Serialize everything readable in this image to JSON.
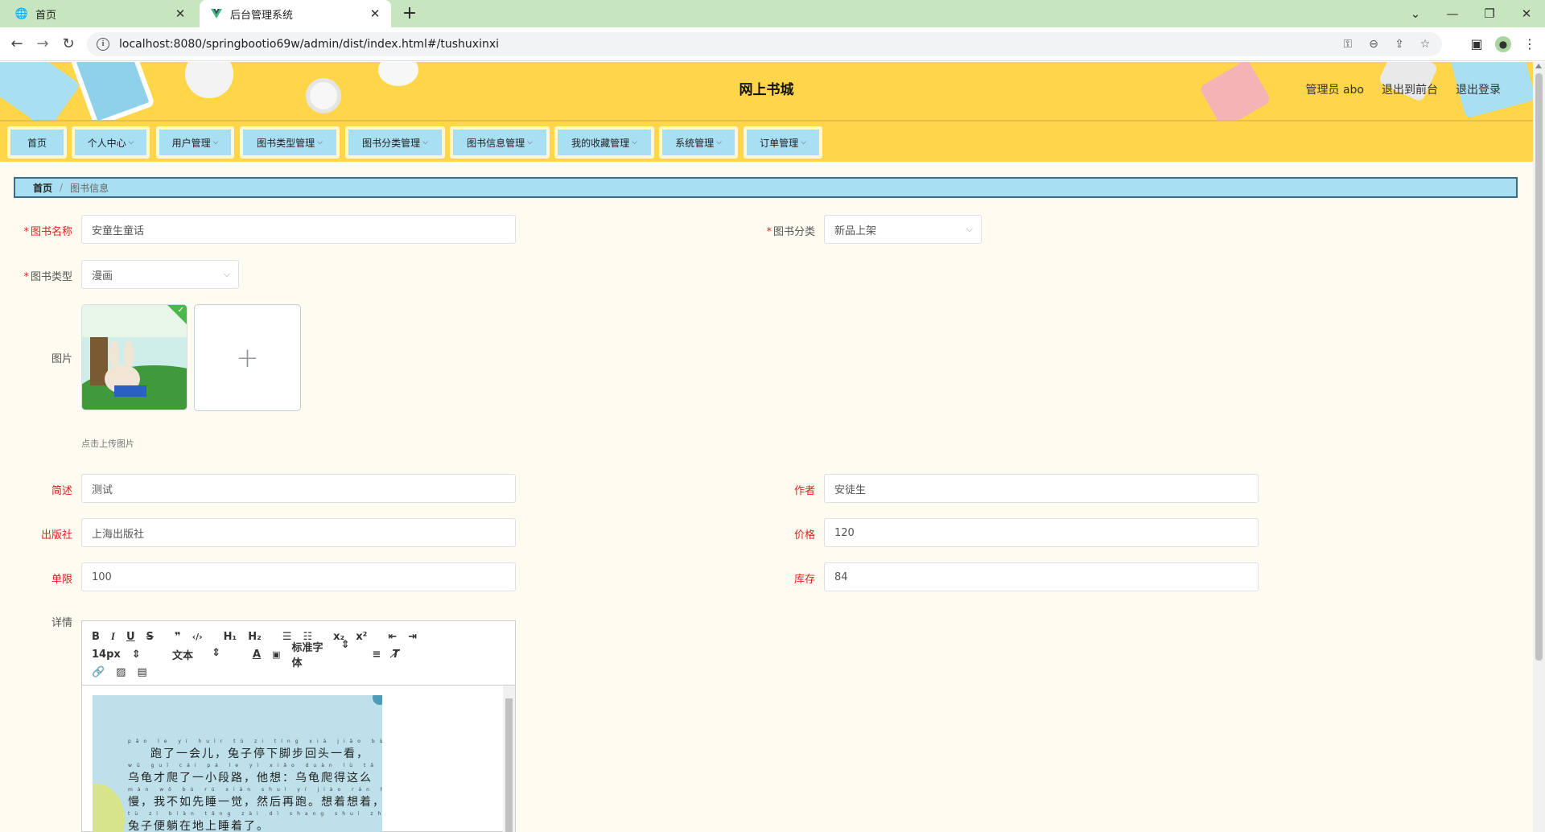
{
  "browser": {
    "tabs": [
      {
        "title": "首页",
        "active": false
      },
      {
        "title": "后台管理系统",
        "active": true
      }
    ],
    "url": "localhost:8080/springbootio69w/admin/dist/index.html#/tushuxinxi"
  },
  "header": {
    "site_title": "网上书城",
    "user_label": "管理员 abo",
    "front_link": "退出到前台",
    "logout_link": "退出登录"
  },
  "menu": [
    {
      "label": "首页",
      "has_dropdown": false
    },
    {
      "label": "个人中心",
      "has_dropdown": true
    },
    {
      "label": "用户管理",
      "has_dropdown": true
    },
    {
      "label": "图书类型管理",
      "has_dropdown": true
    },
    {
      "label": "图书分类管理",
      "has_dropdown": true
    },
    {
      "label": "图书信息管理",
      "has_dropdown": true
    },
    {
      "label": "我的收藏管理",
      "has_dropdown": true
    },
    {
      "label": "系统管理",
      "has_dropdown": true
    },
    {
      "label": "订单管理",
      "has_dropdown": true
    }
  ],
  "breadcrumb": {
    "home": "首页",
    "current": "图书信息"
  },
  "form": {
    "book_name": {
      "label": "图书名称",
      "value": "安童生童话"
    },
    "book_category": {
      "label": "图书分类",
      "value": "新品上架"
    },
    "book_type": {
      "label": "图书类型",
      "value": "漫画"
    },
    "image": {
      "label": "图片",
      "tip": "点击上传图片"
    },
    "summary": {
      "label": "简述",
      "value": "测试"
    },
    "author": {
      "label": "作者",
      "value": "安徒生"
    },
    "publisher": {
      "label": "出版社",
      "value": "上海出版社"
    },
    "price": {
      "label": "价格",
      "value": "120"
    },
    "limit": {
      "label": "单限",
      "value": "100"
    },
    "stock": {
      "label": "库存",
      "value": "84"
    },
    "details": {
      "label": "详情"
    }
  },
  "editor": {
    "font_size": "14px",
    "text_style": "文本",
    "font_family": "标准字体",
    "book_text": [
      "跑了一会儿，兔子停下脚步回头一看，",
      "乌龟才爬了一小段路，他想：乌龟爬得这么",
      "慢，我不如先睡一觉，然后再跑。想着想着，",
      "兔子便躺在地上睡着了。"
    ]
  },
  "colors": {
    "header_bg": "#ffd54a",
    "menu_button_bg": "#a9dff2",
    "page_bg": "#fefcf0",
    "required_label": "#e02020"
  }
}
